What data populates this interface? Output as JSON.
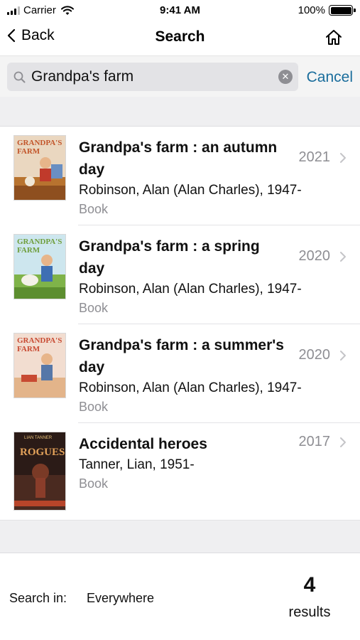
{
  "status_bar": {
    "carrier": "Carrier",
    "time": "9:41 AM",
    "battery": "100%"
  },
  "nav": {
    "back_label": "Back",
    "title": "Search",
    "home_icon": "home-icon"
  },
  "search": {
    "query": "Grandpa's farm",
    "cancel_label": "Cancel",
    "clear_glyph": "✕"
  },
  "results": [
    {
      "title": "Grandpa's farm : an autumn day",
      "author": "Robinson, Alan (Alan Charles), 1947-",
      "type": "Book",
      "year": "2021",
      "cover": {
        "logo": "GRANDPA'S FARM",
        "bg": "#e9d6c2",
        "accent": "#c2552a"
      }
    },
    {
      "title": "Grandpa's farm : a spring day",
      "author": "Robinson, Alan (Alan Charles), 1947-",
      "type": "Book",
      "year": "2020",
      "cover": {
        "logo": "GRANDPA'S FARM",
        "bg": "#cfe7ef",
        "accent": "#6f9e3c"
      }
    },
    {
      "title": "Grandpa's farm : a summer's day",
      "author": "Robinson, Alan (Alan Charles), 1947-",
      "type": "Book",
      "year": "2020",
      "cover": {
        "logo": "GRANDPA'S FARM",
        "bg": "#f3ddd0",
        "accent": "#c84a32"
      }
    },
    {
      "title": "Accidental heroes",
      "author": "Tanner, Lian, 1951-",
      "type": "Book",
      "year": "2017",
      "cover": {
        "logo": "ROGUES",
        "byline": "LIAN TANNER",
        "bg": "#2b1b17",
        "accent": "#b8452a"
      }
    }
  ],
  "footer": {
    "search_in_label": "Search in:",
    "search_in_value": "Everywhere",
    "count": "4",
    "count_label": "results"
  },
  "colors": {
    "accent": "#1a6d9c",
    "secondary_text": "#8e8e93",
    "band": "#efeff1"
  }
}
